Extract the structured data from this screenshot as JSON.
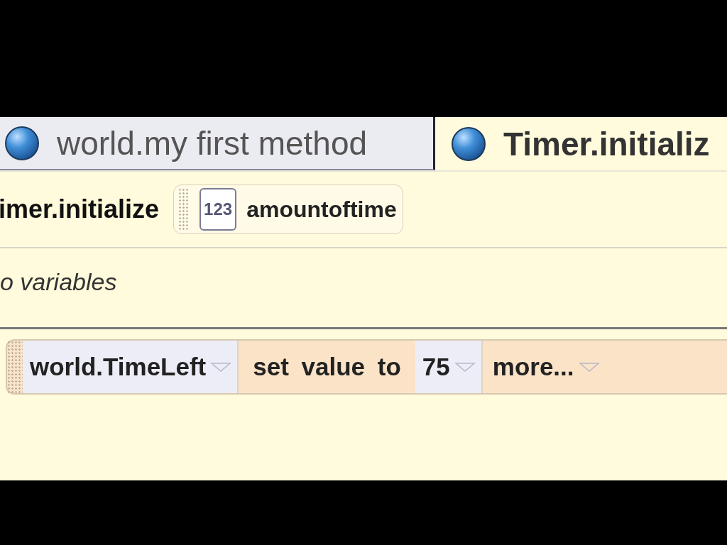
{
  "tabs": [
    {
      "label": "world.my first method",
      "selected": false
    },
    {
      "label": "Timer.initializ",
      "selected": true
    }
  ],
  "method_header": {
    "name": "imer.initialize",
    "parameters": [
      {
        "type_label": "123",
        "name": "amountoftime"
      }
    ]
  },
  "variables_note": "o variables",
  "statements": [
    {
      "target": "world.TimeLeft",
      "action": "set value to",
      "value": "75",
      "more": "more..."
    }
  ]
}
